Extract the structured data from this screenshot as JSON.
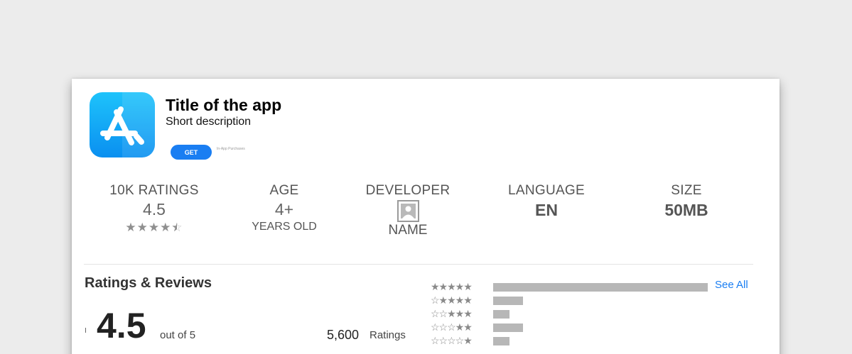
{
  "app": {
    "title": "Title of the app",
    "description": "Short description",
    "get_label": "GET",
    "in_app": "In-App Purchases",
    "icon": "app-store-icon",
    "accent": "#1a7ef2"
  },
  "stats": [
    {
      "label": "10K RATINGS",
      "value": "4.5",
      "stars": 4.5
    },
    {
      "label": "AGE",
      "value": "4+",
      "sub": "YEARS OLD"
    },
    {
      "label": "DEVELOPER",
      "icon": "developer-image-placeholder-icon",
      "sub": "NAME"
    },
    {
      "label": "LANGUAGE",
      "value": "EN"
    },
    {
      "label": "SIZE",
      "value": "50MB"
    }
  ],
  "reviews": {
    "title": "Ratings & Reviews",
    "see_all": "See All",
    "rating": "4.5",
    "out_of": "out of 5",
    "count": "5,600",
    "count_label": "Ratings",
    "histogram": [
      {
        "stars": 5,
        "fraction": 1.0
      },
      {
        "stars": 4,
        "fraction": 0.14
      },
      {
        "stars": 3,
        "fraction": 0.075
      },
      {
        "stars": 2,
        "fraction": 0.14
      },
      {
        "stars": 1,
        "fraction": 0.075
      }
    ]
  }
}
